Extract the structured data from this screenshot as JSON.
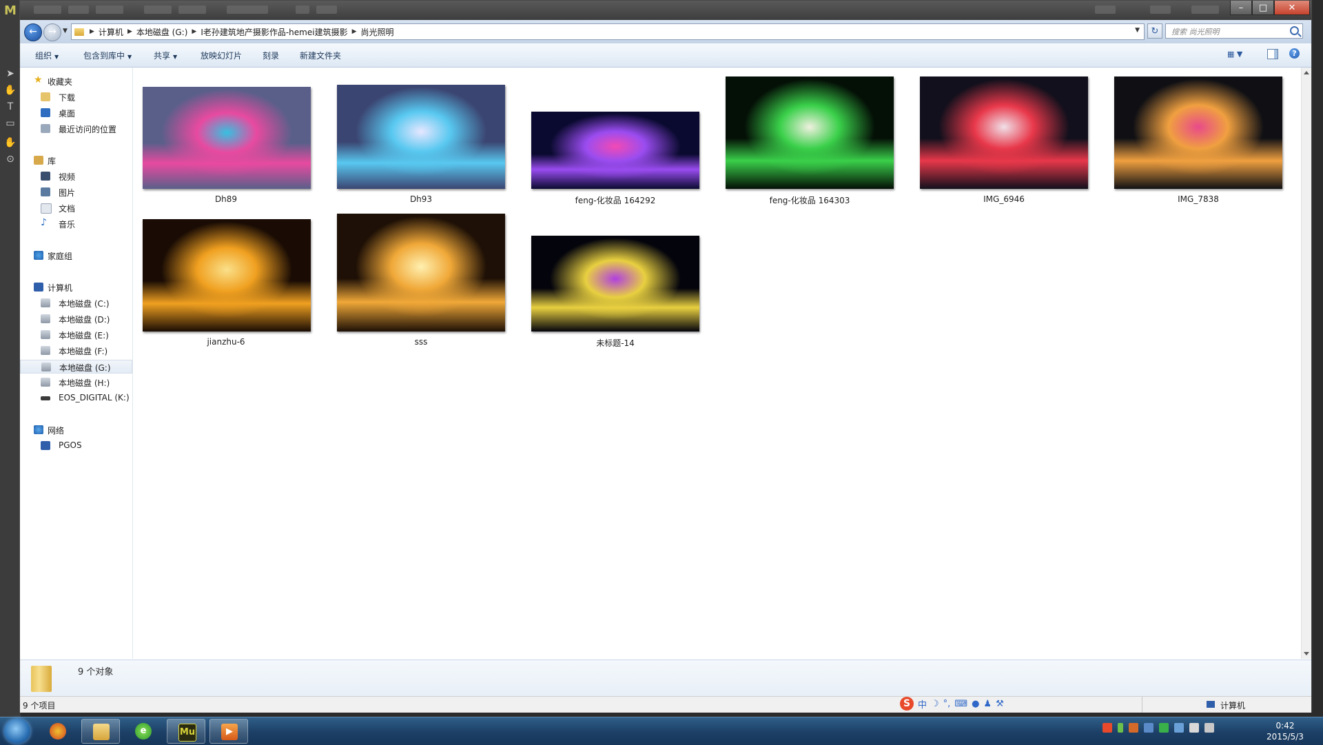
{
  "window": {
    "address_crumbs": [
      "计算机",
      "本地磁盘 (G:)",
      "I老孙建筑地产摄影作品-hemei建筑摄影",
      "尚光照明"
    ],
    "search_placeholder": "搜索 尚光照明"
  },
  "toolbar": {
    "organize": "组织",
    "include_in_library": "包含到库中",
    "share": "共享",
    "slideshow": "放映幻灯片",
    "burn": "刻录",
    "new_folder": "新建文件夹"
  },
  "sidebar": {
    "favorites": "收藏夹",
    "downloads": "下载",
    "desktop": "桌面",
    "recent_places": "最近访问的位置",
    "libraries": "库",
    "videos": "视频",
    "pictures": "图片",
    "documents": "文档",
    "music": "音乐",
    "homegroup": "家庭组",
    "computer": "计算机",
    "drives": [
      "本地磁盘 (C:)",
      "本地磁盘 (D:)",
      "本地磁盘 (E:)",
      "本地磁盘 (F:)",
      "本地磁盘 (G:)",
      "本地磁盘 (H:)",
      "EOS_DIGITAL (K:)"
    ],
    "selected_drive": "本地磁盘 (G:)",
    "network": "网络",
    "network_host": "PGOS"
  },
  "files": [
    {
      "name": "Dh89",
      "colors": [
        "#5a5f8a",
        "#e84aa0",
        "#37c0e0"
      ]
    },
    {
      "name": "Dh93",
      "colors": [
        "#3b4572",
        "#58c8f0",
        "#e7e7ff"
      ]
    },
    {
      "name": "feng-化妆品 164292",
      "colors": [
        "#0a0a30",
        "#9a4cf0",
        "#f24ab4"
      ]
    },
    {
      "name": "feng-化妆品 164303",
      "colors": [
        "#041006",
        "#3ad04a",
        "#f0f0e0"
      ]
    },
    {
      "name": "IMG_6946",
      "colors": [
        "#12101c",
        "#e8384a",
        "#f0e0e8"
      ]
    },
    {
      "name": "IMG_7838",
      "colors": [
        "#101014",
        "#f0a040",
        "#e84a8a"
      ]
    },
    {
      "name": "jianzhu-6",
      "colors": [
        "#1a0c04",
        "#f0a020",
        "#fae08a"
      ]
    },
    {
      "name": "sss",
      "colors": [
        "#1e1006",
        "#f0a838",
        "#fff0b0"
      ]
    },
    {
      "name": "未标题-14",
      "colors": [
        "#04040c",
        "#e8d040",
        "#b040e0"
      ]
    }
  ],
  "details": {
    "count": "9 个对象"
  },
  "statusbar": {
    "items": "9 个项目",
    "location": "计算机"
  },
  "ime": {
    "mode": "中"
  },
  "taskbar": {
    "time": "0:42",
    "date": "2015/5/3",
    "apps": [
      "photoshop",
      "explorer",
      "browser",
      "muse",
      "media-player"
    ]
  }
}
